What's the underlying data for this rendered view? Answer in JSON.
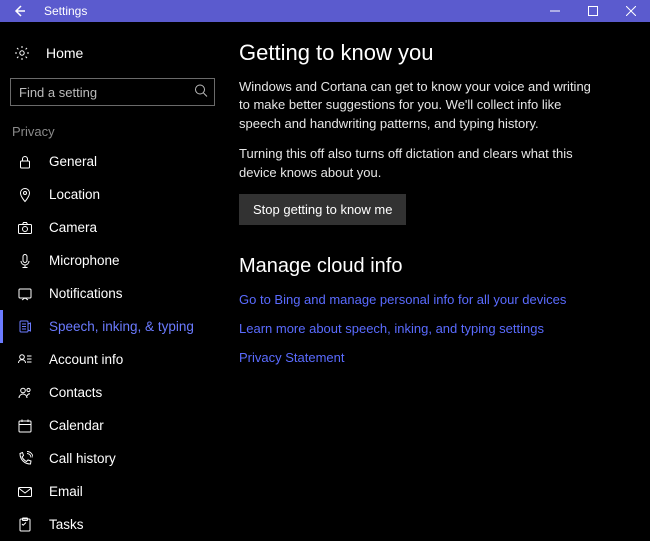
{
  "titlebar": {
    "title": "Settings"
  },
  "sidebar": {
    "home_label": "Home",
    "search_placeholder": "Find a setting",
    "section_label": "Privacy",
    "items": [
      {
        "label": "General",
        "icon": "lock-icon"
      },
      {
        "label": "Location",
        "icon": "location-icon"
      },
      {
        "label": "Camera",
        "icon": "camera-icon"
      },
      {
        "label": "Microphone",
        "icon": "microphone-icon"
      },
      {
        "label": "Notifications",
        "icon": "notification-icon"
      },
      {
        "label": "Speech, inking, & typing",
        "icon": "speech-icon",
        "selected": true
      },
      {
        "label": "Account info",
        "icon": "account-icon"
      },
      {
        "label": "Contacts",
        "icon": "contacts-icon"
      },
      {
        "label": "Calendar",
        "icon": "calendar-icon"
      },
      {
        "label": "Call history",
        "icon": "callhistory-icon"
      },
      {
        "label": "Email",
        "icon": "email-icon"
      },
      {
        "label": "Tasks",
        "icon": "tasks-icon"
      }
    ]
  },
  "content": {
    "heading1": "Getting to know you",
    "para1": "Windows and Cortana can get to know your voice and writing to make better suggestions for you. We'll collect info like speech and handwriting patterns, and typing history.",
    "para2": "Turning this off also turns off dictation and clears what this device knows about you.",
    "button_label": "Stop getting to know me",
    "heading2": "Manage cloud info",
    "links": [
      "Go to Bing and manage personal info for all your devices",
      "Learn more about speech, inking, and typing settings",
      "Privacy Statement"
    ]
  }
}
